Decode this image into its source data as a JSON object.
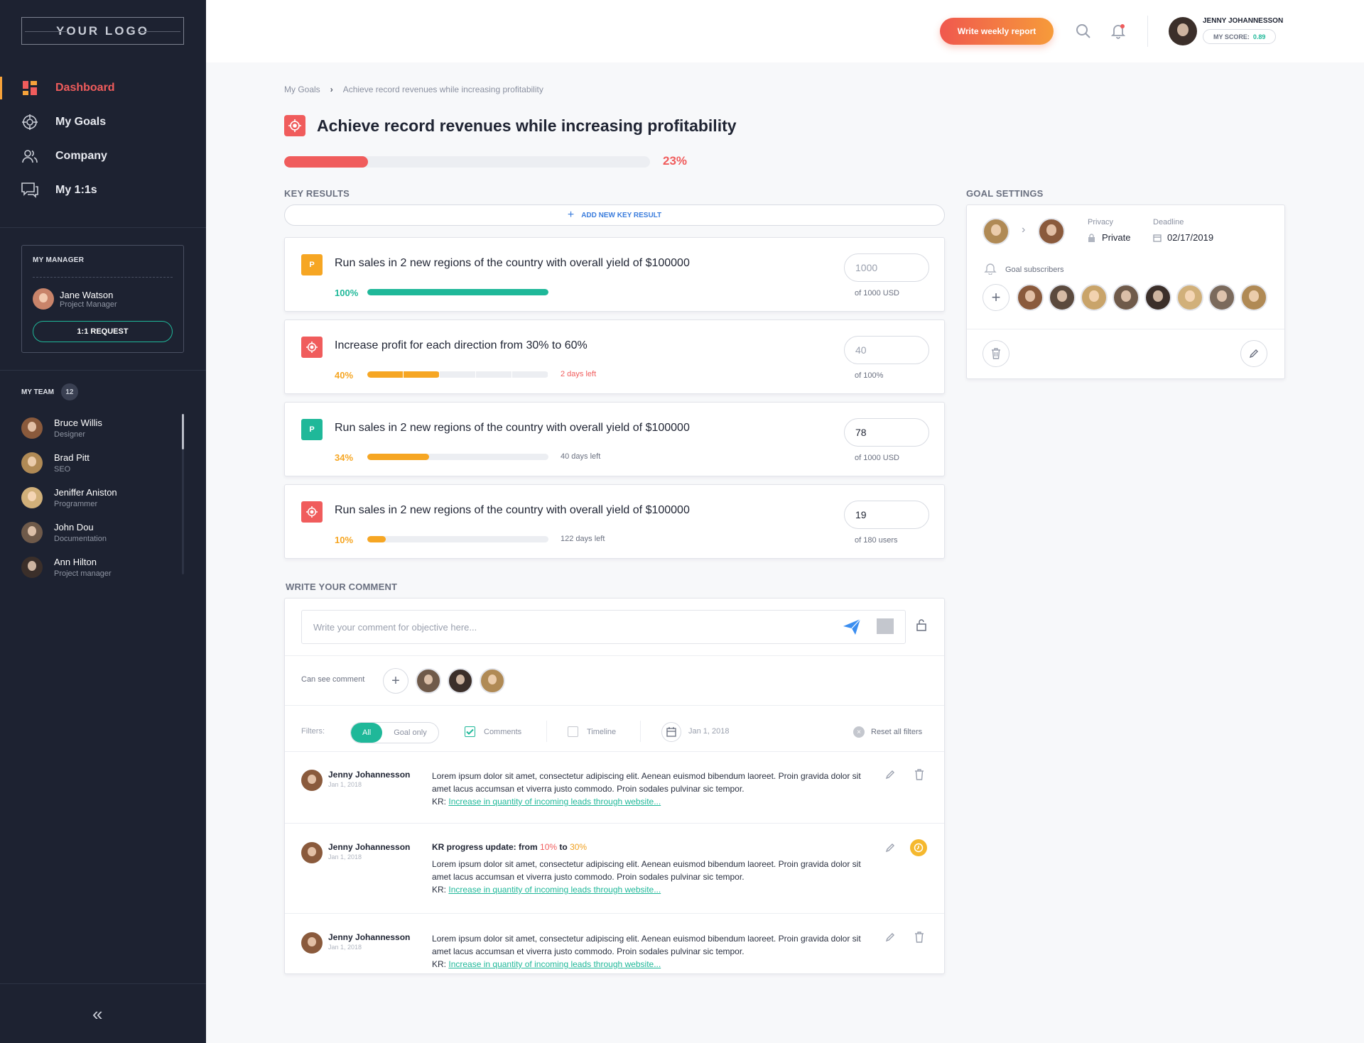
{
  "sidebar": {
    "logo": "YOUR LOGO",
    "nav": [
      {
        "label": "Dashboard",
        "icon": "dashboard-icon",
        "active": true
      },
      {
        "label": "My Goals",
        "icon": "target-icon"
      },
      {
        "label": "Company",
        "icon": "users-icon"
      },
      {
        "label": "My 1:1s",
        "icon": "chat-icon"
      }
    ],
    "manager": {
      "title": "MY MANAGER",
      "name": "Jane Watson",
      "role": "Project Manager",
      "button": "1:1 REQUEST"
    },
    "team": {
      "title": "MY TEAM",
      "count": "12",
      "members": [
        {
          "name": "Bruce Willis",
          "role": "Designer"
        },
        {
          "name": "Brad Pitt",
          "role": "SEO"
        },
        {
          "name": "Jeniffer Aniston",
          "role": "Programmer"
        },
        {
          "name": "John Dou",
          "role": "Documentation"
        },
        {
          "name": "Ann Hilton",
          "role": "Project manager"
        }
      ]
    },
    "collapse": "«"
  },
  "header": {
    "report_button": "Write weekly report",
    "user_name": "JENNY JOHANNESSON",
    "score_label": "MY SCORE:",
    "score_value": "0.89"
  },
  "breadcrumb": {
    "root": "My Goals",
    "current": "Achieve record revenues while increasing profitability"
  },
  "goal": {
    "title": "Achieve record revenues while increasing profitability",
    "progress_pct": "23%",
    "progress_value": 0.23
  },
  "key_results": {
    "section_label": "KEY RESULTS",
    "add_label": "ADD NEW KEY RESULT",
    "items": [
      {
        "badge": "P",
        "badge_color": "#f6a623",
        "title": "Run sales in 2 new regions of the country with overall yield of $100000",
        "pct": "100%",
        "progress": 1.0,
        "bar_color": "#1fb899",
        "pct_color": "#1fb899",
        "days": "",
        "input_value": "",
        "placeholder": "1000",
        "of": "of  1000 USD"
      },
      {
        "badge": "target",
        "badge_color": "#f05c5c",
        "title": "Increase profit for each direction from 30% to 60%",
        "pct": "40%",
        "progress": 0.4,
        "bar_color": "#f6a623",
        "pct_color": "#f6a623",
        "days": "2 days left",
        "days_color": "#f05c5c",
        "input_value": "",
        "placeholder": "40",
        "of": "of  100%"
      },
      {
        "badge": "P",
        "badge_color": "#1fb899",
        "title": "Run sales in 2 new regions of the country with overall yield of $100000",
        "pct": "34%",
        "progress": 0.34,
        "bar_color": "#f6a623",
        "pct_color": "#f6a623",
        "days": "40 days left",
        "days_color": "#6a7080",
        "input_value": "78",
        "placeholder": "",
        "of": "of  1000 USD"
      },
      {
        "badge": "target",
        "badge_color": "#f05c5c",
        "title": "Run sales in 2 new regions of the country with overall yield of $100000",
        "pct": "10%",
        "progress": 0.1,
        "bar_color": "#f6a623",
        "pct_color": "#f6a623",
        "days": "122 days left",
        "days_color": "#6a7080",
        "input_value": "19",
        "placeholder": "",
        "of": "of  180 users"
      }
    ]
  },
  "goal_settings": {
    "section_label": "GOAL SETTINGS",
    "privacy_label": "Privacy",
    "privacy_value": "Private",
    "deadline_label": "Deadline",
    "deadline_value": "02/17/2019",
    "subscribers_label": "Goal subscribers"
  },
  "comments": {
    "section_label": "WRITE YOUR COMMENT",
    "placeholder": "Write your comment for objective here...",
    "can_see_label": "Can see comment",
    "filters": {
      "label": "Filters:",
      "all": "All",
      "goal_only": "Goal only",
      "comments": "Comments",
      "timeline": "Timeline",
      "date": "Jan 1, 2018",
      "reset": "Reset all filters"
    },
    "items": [
      {
        "name": "Jenny Johannesson",
        "date": "Jan 1, 2018",
        "text": "Lorem ipsum dolor sit amet, consectetur adipiscing elit. Aenean euismod bibendum laoreet. Proin gravida dolor sit amet lacus accumsan et viverra justo commodo. Proin sodales pulvinar sic tempor.",
        "kr_prefix": "KR:",
        "kr_link": "Increase in quantity of incoming leads through website..."
      },
      {
        "name": "Jenny Johannesson",
        "date": "Jan 1, 2018",
        "update_prefix": "KR progress update: from",
        "update_from": "10%",
        "update_to_word": "to",
        "update_to": "30%",
        "text": "Lorem ipsum dolor sit amet, consectetur adipiscing elit. Aenean euismod bibendum laoreet. Proin gravida dolor sit amet lacus accumsan et viverra justo commodo. Proin sodales pulvinar sic tempor.",
        "kr_prefix": "KR:",
        "kr_link": "Increase in quantity of incoming leads through website..."
      },
      {
        "name": "Jenny Johannesson",
        "date": "Jan 1, 2018",
        "text": "Lorem ipsum dolor sit amet, consectetur adipiscing elit. Aenean euismod bibendum laoreet. Proin gravida dolor sit amet lacus accumsan et viverra justo commodo. Proin sodales pulvinar sic tempor.",
        "kr_prefix": "KR:",
        "kr_link": "Increase in quantity of incoming leads through website..."
      }
    ]
  },
  "avatar_colors": [
    "#8a5a3c",
    "#5b4a3e",
    "#c9a46a",
    "#6f5a4a",
    "#3b2f2a",
    "#d1b07a",
    "#7b6a5c",
    "#b08a55"
  ]
}
